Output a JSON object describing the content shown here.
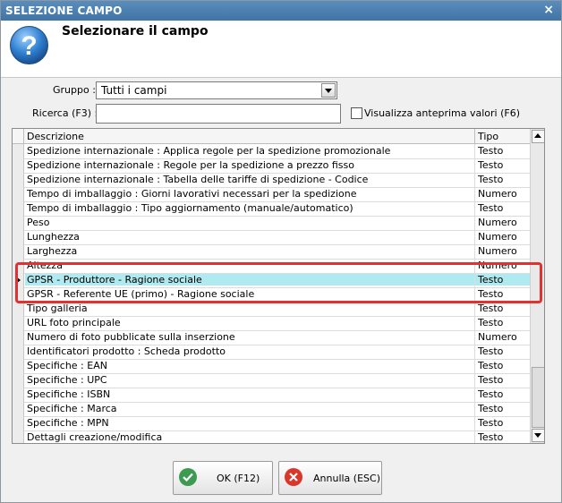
{
  "window": {
    "title": "SELEZIONE CAMPO",
    "close_glyph": "×"
  },
  "header": {
    "title": "Selezionare il campo",
    "icon": "help-question-icon"
  },
  "filters": {
    "group_label": "Gruppo :",
    "group_value": "Tutti i campi",
    "search_label": "Ricerca (F3) :",
    "search_value": "",
    "preview_label": "Visualizza anteprima valori (F6)",
    "preview_checked": false
  },
  "grid": {
    "columns": [
      "Descrizione",
      "Tipo"
    ],
    "rows": [
      [
        "Spedizione internazionale : Applica regole per la spedizione promozionale",
        "Testo"
      ],
      [
        "Spedizione internazionale : Regole per la spedizione a prezzo fisso",
        "Testo"
      ],
      [
        "Spedizione internazionale : Tabella delle tariffe di spedizione - Codice",
        "Testo"
      ],
      [
        "Tempo di imballaggio : Giorni lavorativi necessari per la spedizione",
        "Numero"
      ],
      [
        "Tempo di imballaggio : Tipo aggiornamento (manuale/automatico)",
        "Testo"
      ],
      [
        "Peso",
        "Numero"
      ],
      [
        "Lunghezza",
        "Numero"
      ],
      [
        "Larghezza",
        "Numero"
      ],
      [
        "Altezza",
        "Numero"
      ],
      [
        "GPSR - Produttore - Ragione sociale",
        "Testo"
      ],
      [
        "GPSR - Referente UE (primo) - Ragione sociale",
        "Testo"
      ],
      [
        "Tipo galleria",
        "Testo"
      ],
      [
        "URL foto principale",
        "Testo"
      ],
      [
        "Numero di foto pubblicate sulla inserzione",
        "Numero"
      ],
      [
        "Identificatori prodotto : Scheda prodotto",
        "Testo"
      ],
      [
        "Specifiche : EAN",
        "Testo"
      ],
      [
        "Specifiche : UPC",
        "Testo"
      ],
      [
        "Specifiche : ISBN",
        "Testo"
      ],
      [
        "Specifiche : Marca",
        "Testo"
      ],
      [
        "Specifiche : MPN",
        "Testo"
      ],
      [
        "Dettagli creazione/modifica",
        "Testo"
      ]
    ],
    "selected_row": 9
  },
  "buttons": {
    "ok_label": "OK (F12)",
    "cancel_label": "Annulla (ESC)"
  },
  "colors": {
    "selection": "#aeeaf0",
    "highlight_box": "#e23131",
    "title_bar": "#4a80b2"
  }
}
